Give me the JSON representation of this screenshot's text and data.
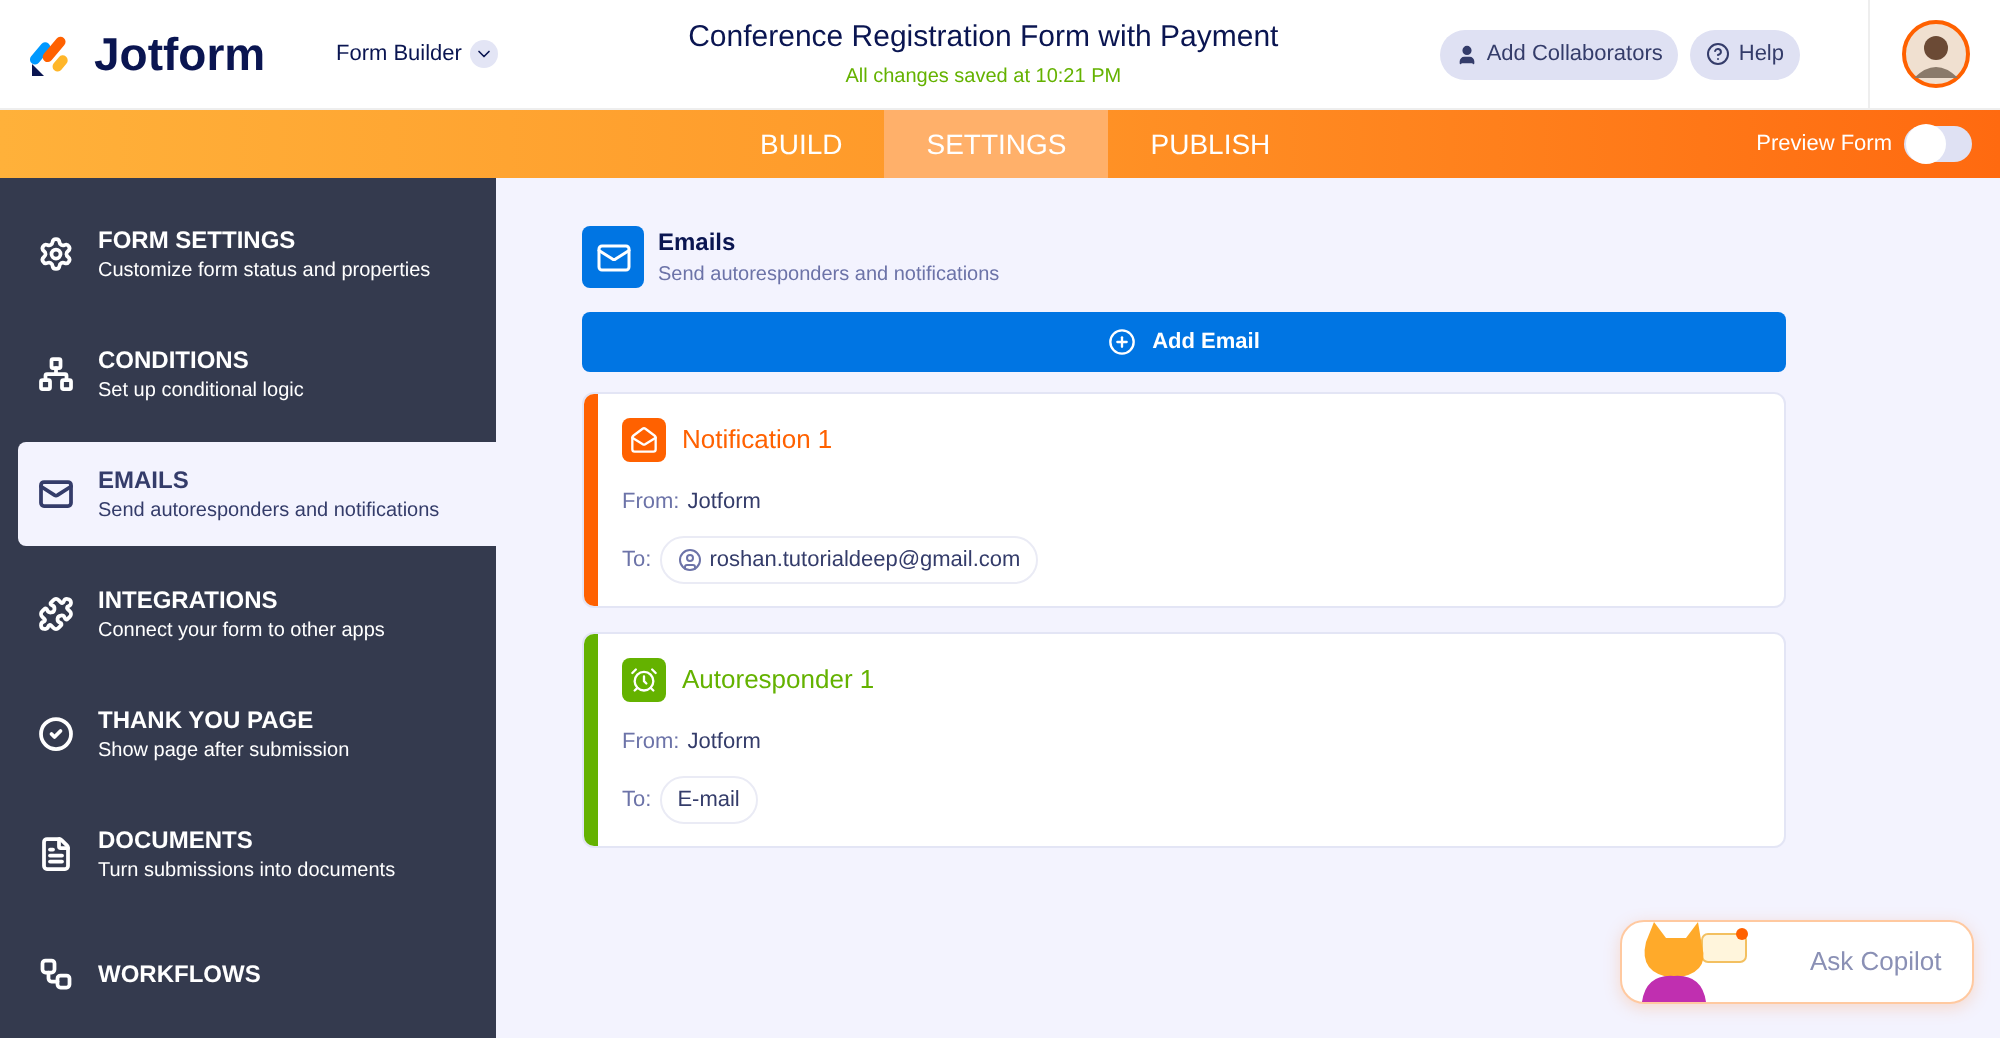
{
  "header": {
    "brand": "Jotform",
    "builder_menu": "Form Builder",
    "title": "Conference Registration Form with Payment",
    "save_status": "All changes saved at 10:21 PM",
    "buttons": [
      "Add Collaborators",
      "Help"
    ]
  },
  "tabs": [
    {
      "label": "BUILD",
      "selected": false
    },
    {
      "label": "SETTINGS",
      "selected": true
    },
    {
      "label": "PUBLISH",
      "selected": false
    }
  ],
  "preview": {
    "label": "Preview Form",
    "on": false
  },
  "sidebar": {
    "items": [
      {
        "title": "FORM SETTINGS",
        "subtitle": "Customize form status and properties",
        "selected": false
      },
      {
        "title": "CONDITIONS",
        "subtitle": "Set up conditional logic",
        "selected": false
      },
      {
        "title": "EMAILS",
        "subtitle": "Send autoresponders and notifications",
        "selected": true
      },
      {
        "title": "INTEGRATIONS",
        "subtitle": "Connect your form to other apps",
        "selected": false
      },
      {
        "title": "THANK YOU PAGE",
        "subtitle": "Show page after submission",
        "selected": false
      },
      {
        "title": "DOCUMENTS",
        "subtitle": "Turn submissions into documents",
        "selected": false
      },
      {
        "title": "WORKFLOWS",
        "selected": false
      }
    ]
  },
  "section": {
    "title": "Emails",
    "subtitle": "Send autoresponders and notifications",
    "add_button": "Add Email"
  },
  "emails": [
    {
      "kind": "notification",
      "color": "#ff6100",
      "title": "Notification 1",
      "from_label": "From:",
      "from": "Jotform",
      "to_label": "To:",
      "to": "roshan.tutorialdeep@gmail.com",
      "to_avatar": true
    },
    {
      "kind": "autoresponder",
      "color": "#64b200",
      "title": "Autoresponder 1",
      "from_label": "From:",
      "from": "Jotform",
      "to_label": "To:",
      "to": "E-mail",
      "to_avatar": false
    }
  ],
  "copilot": {
    "label": "Ask Copilot"
  }
}
